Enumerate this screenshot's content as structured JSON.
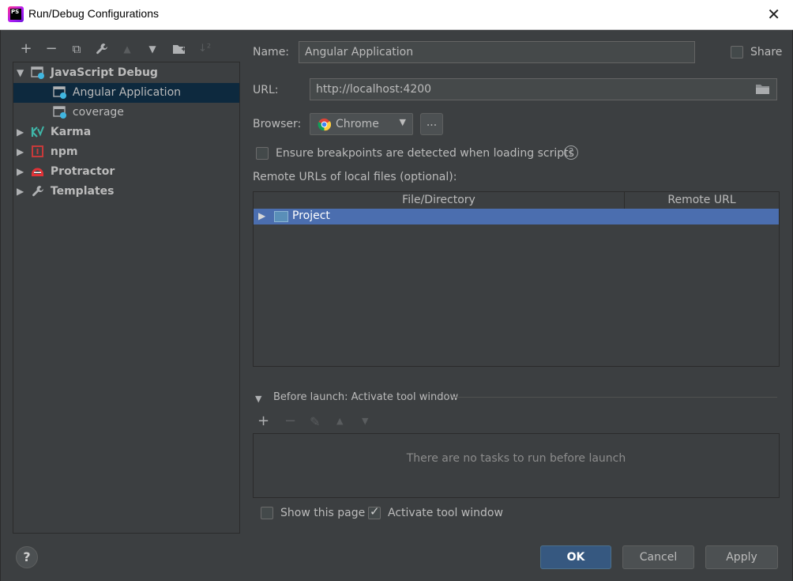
{
  "window": {
    "title": "Run/Debug Configurations",
    "app_icon_text": "PS"
  },
  "toolbar": {
    "items": [
      {
        "name": "add-icon",
        "glyph": "+",
        "enabled": true
      },
      {
        "name": "remove-icon",
        "glyph": "−",
        "enabled": true
      },
      {
        "name": "copy-icon",
        "glyph": "⧉",
        "enabled": true
      },
      {
        "name": "wrench-icon",
        "glyph": "🔧",
        "enabled": true
      },
      {
        "name": "move-up-icon",
        "glyph": "▲",
        "enabled": false
      },
      {
        "name": "move-down-icon",
        "glyph": "▼",
        "enabled": true
      },
      {
        "name": "new-folder-icon",
        "glyph": "▆",
        "enabled": true
      },
      {
        "name": "sort-icon",
        "glyph": "↓",
        "enabled": false
      }
    ]
  },
  "tree": {
    "items": [
      {
        "label": "JavaScript Debug",
        "bold": true,
        "expanded": true,
        "level": 0,
        "icon": "javascript-debug-icon"
      },
      {
        "label": "Angular Application",
        "bold": false,
        "level": 1,
        "selected": true,
        "icon": "debug-config-icon"
      },
      {
        "label": "coverage",
        "bold": false,
        "level": 1,
        "icon": "debug-config-icon"
      },
      {
        "label": "Karma",
        "bold": true,
        "expanded": false,
        "level": 0,
        "icon": "karma-icon"
      },
      {
        "label": "npm",
        "bold": true,
        "expanded": false,
        "level": 0,
        "icon": "npm-icon"
      },
      {
        "label": "Protractor",
        "bold": true,
        "expanded": false,
        "level": 0,
        "icon": "protractor-icon"
      },
      {
        "label": "Templates",
        "bold": true,
        "expanded": false,
        "level": 0,
        "icon": "wrench-icon"
      }
    ]
  },
  "form": {
    "name_label": "Name:",
    "name_value": "Angular Application",
    "share_label": "Share",
    "url_label": "URL:",
    "url_value": "http://localhost:4200",
    "browser_label": "Browser:",
    "browser_value": "Chrome",
    "browse_button": "...",
    "breakpoints_label": "Ensure breakpoints are detected when loading scripts",
    "remote_urls_label": "Remote URLs of local files (optional):"
  },
  "table": {
    "columns": [
      "File/Directory",
      "Remote URL"
    ],
    "rows": [
      {
        "file": "Project",
        "remote": ""
      }
    ]
  },
  "before_launch": {
    "title": "Before launch: Activate tool window",
    "empty_text": "There are no tasks to run before launch",
    "show_page_label": "Show this page",
    "show_page_checked": false,
    "activate_label": "Activate tool window",
    "activate_checked": true
  },
  "buttons": {
    "ok": "OK",
    "cancel": "Cancel",
    "apply": "Apply",
    "help": "?"
  },
  "colors": {
    "background": "#3c3f41",
    "selection": "#0d293e",
    "table_selection": "#4b6eaf",
    "primary_button": "#365880"
  }
}
